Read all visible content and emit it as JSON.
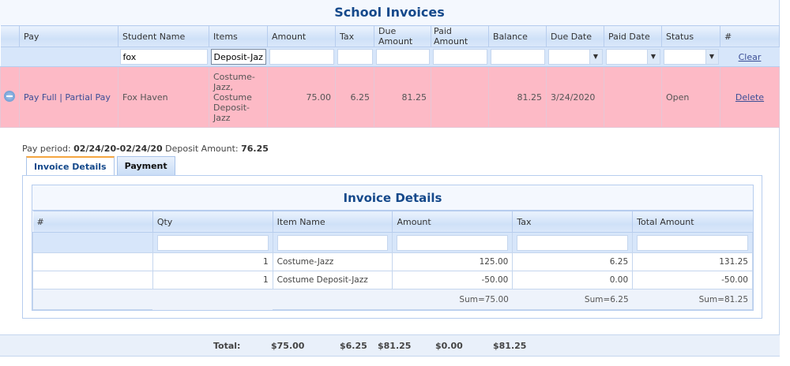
{
  "title": "School Invoices",
  "columns": [
    "Pay",
    "Student Name",
    "Items",
    "Amount",
    "Tax",
    "Due Amount",
    "Paid Amount",
    "Balance",
    "Due Date",
    "Paid Date",
    "Status",
    "#"
  ],
  "filters": {
    "student_name": "fox",
    "items": "Deposit-Jazz",
    "clear_label": "Clear",
    "dropdown_arrow": "▼"
  },
  "row": {
    "pay_full": "Pay Full",
    "separator": "|",
    "partial_pay": "Partial Pay",
    "student": "Fox Haven",
    "items": "Costume-Jazz, Costume Deposit-Jazz",
    "amount": "75.00",
    "tax": "6.25",
    "due_amount": "81.25",
    "paid_amount": "",
    "balance": "81.25",
    "due_date": "3/24/2020",
    "paid_date": "",
    "status": "Open",
    "delete_label": "Delete",
    "row_color": "#fdbac6"
  },
  "details": {
    "pay_period_label": "Pay period:",
    "pay_period": "02/24/20-02/24/20",
    "deposit_label": "Deposit Amount:",
    "deposit": "76.25",
    "tabs": [
      "Invoice Details",
      "Payment"
    ],
    "title": "Invoice Details",
    "columns": [
      "#",
      "Qty",
      "Item Name",
      "Amount",
      "Tax",
      "Total Amount"
    ],
    "rows": [
      {
        "qty": "1",
        "item": "Costume-Jazz",
        "amount": "125.00",
        "tax": "6.25",
        "total": "131.25"
      },
      {
        "qty": "1",
        "item": "Costume Deposit-Jazz",
        "amount": "-50.00",
        "tax": "0.00",
        "total": "-50.00"
      }
    ],
    "sums": {
      "amount": "Sum=75.00",
      "tax": "Sum=6.25",
      "total": "Sum=81.25"
    }
  },
  "footer": {
    "label": "Total:",
    "amount": "$75.00",
    "tax": "$6.25",
    "due": "$81.25",
    "paid": "$0.00",
    "balance": "$81.25"
  }
}
